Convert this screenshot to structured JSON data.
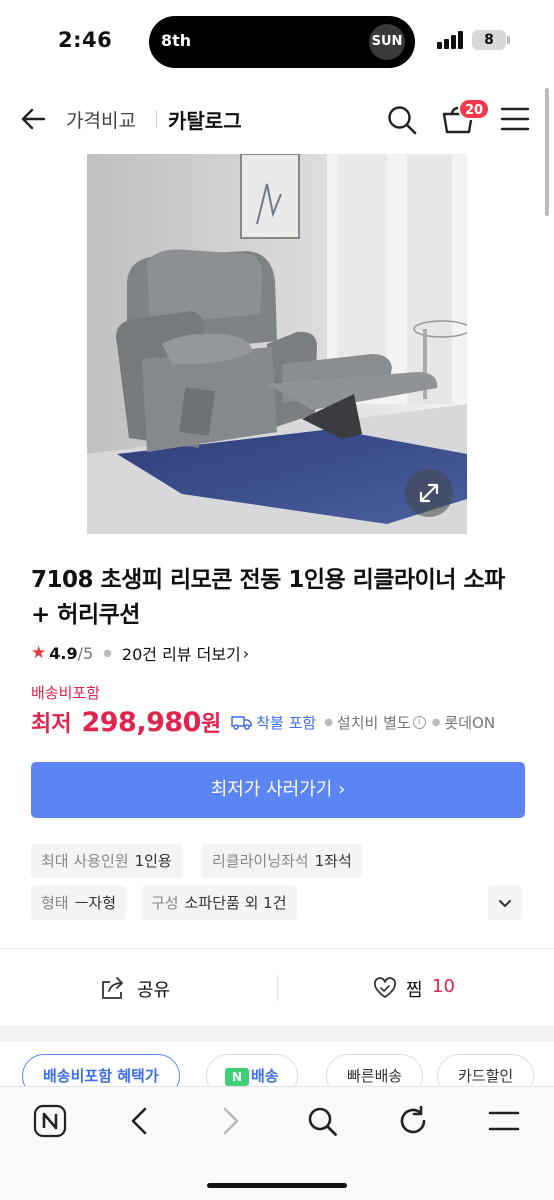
{
  "status_bar": {
    "time": "2:46",
    "island_left": "8th",
    "island_right": "SUN",
    "battery": "8"
  },
  "header": {
    "tab_compare": "가격비교",
    "tab_catalog": "카탈로그",
    "cart_count": "20"
  },
  "product": {
    "title": "7108 초생피 리모콘 전동 1인용 리클라이너 소파 + 허리쿠션",
    "rating": "4.9",
    "rating_max": "/5",
    "reviews": "20건 리뷰 더보기",
    "shipping_included": "배송비포함",
    "price_label": "최저",
    "price": "298,980",
    "currency": "원",
    "free_install": "착불 포함",
    "install_fee": "설치비 별도",
    "seller": "롯데ON",
    "buy_button": "최저가 사러가기"
  },
  "specs": [
    {
      "key": "최대 사용인원",
      "value": "1인용"
    },
    {
      "key": "리클라이닝좌석",
      "value": "1좌석"
    },
    {
      "key": "형태",
      "value": "ㅡ자형"
    },
    {
      "key": "구성",
      "value": "소파단품 외 1건"
    }
  ],
  "actions": {
    "share": "공유",
    "like": "찜",
    "like_count": "10"
  },
  "filters": [
    "배송비포함 혜택가",
    "배송",
    "빠른배송",
    "카드할인"
  ],
  "colors": {
    "accent": "#5b85f2",
    "price": "#e0244b",
    "badge": "#f2394a"
  }
}
